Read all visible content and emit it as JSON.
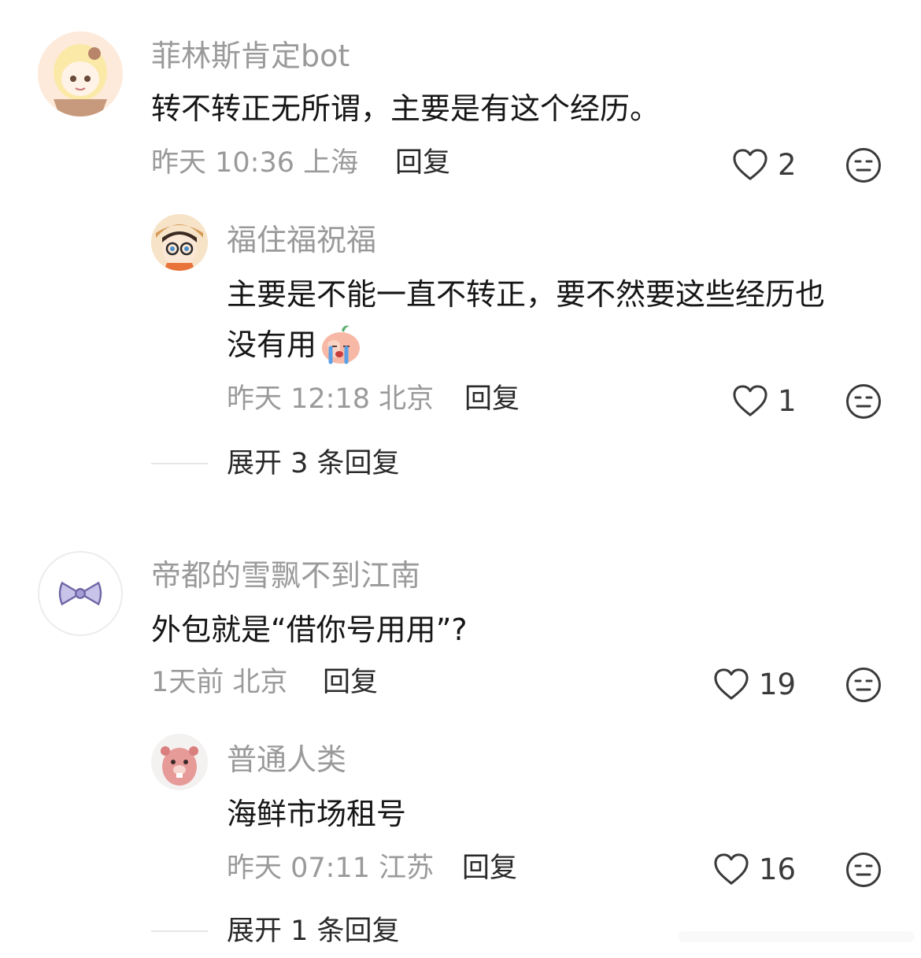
{
  "comments": [
    {
      "user": "菲林斯肯定bot",
      "text": "转不转正无所谓，主要是有这个经历。",
      "time": "昨天 10:36 上海",
      "reply_label": "回复",
      "likes": "2",
      "replies": [
        {
          "user": "福住福祝福",
          "text_line1": "主要是不能一直不转正，要不然要这些经历也",
          "text_line2": "没有用",
          "emoji": "crying-face-sticker",
          "time": "昨天 12:18 北京",
          "reply_label": "回复",
          "likes": "1"
        }
      ],
      "expand_label": "展开 3 条回复"
    },
    {
      "user": "帝都的雪飘不到江南",
      "text": "外包就是“借你号用用”?",
      "time": "1天前 北京",
      "reply_label": "回复",
      "likes": "19",
      "replies": [
        {
          "user": "普通人类",
          "text": "海鲜市场租号",
          "time": "昨天 07:11 江苏",
          "reply_label": "回复",
          "likes": "16"
        }
      ],
      "expand_label": "展开 1 条回复"
    }
  ],
  "icons": {
    "like": "heart-outline-icon",
    "dislike": "expressionless-face-icon"
  },
  "colors": {
    "username": "#9a9a9a",
    "text": "#161616",
    "meta": "#9a9a9a",
    "icon": "#3a3a3a"
  }
}
